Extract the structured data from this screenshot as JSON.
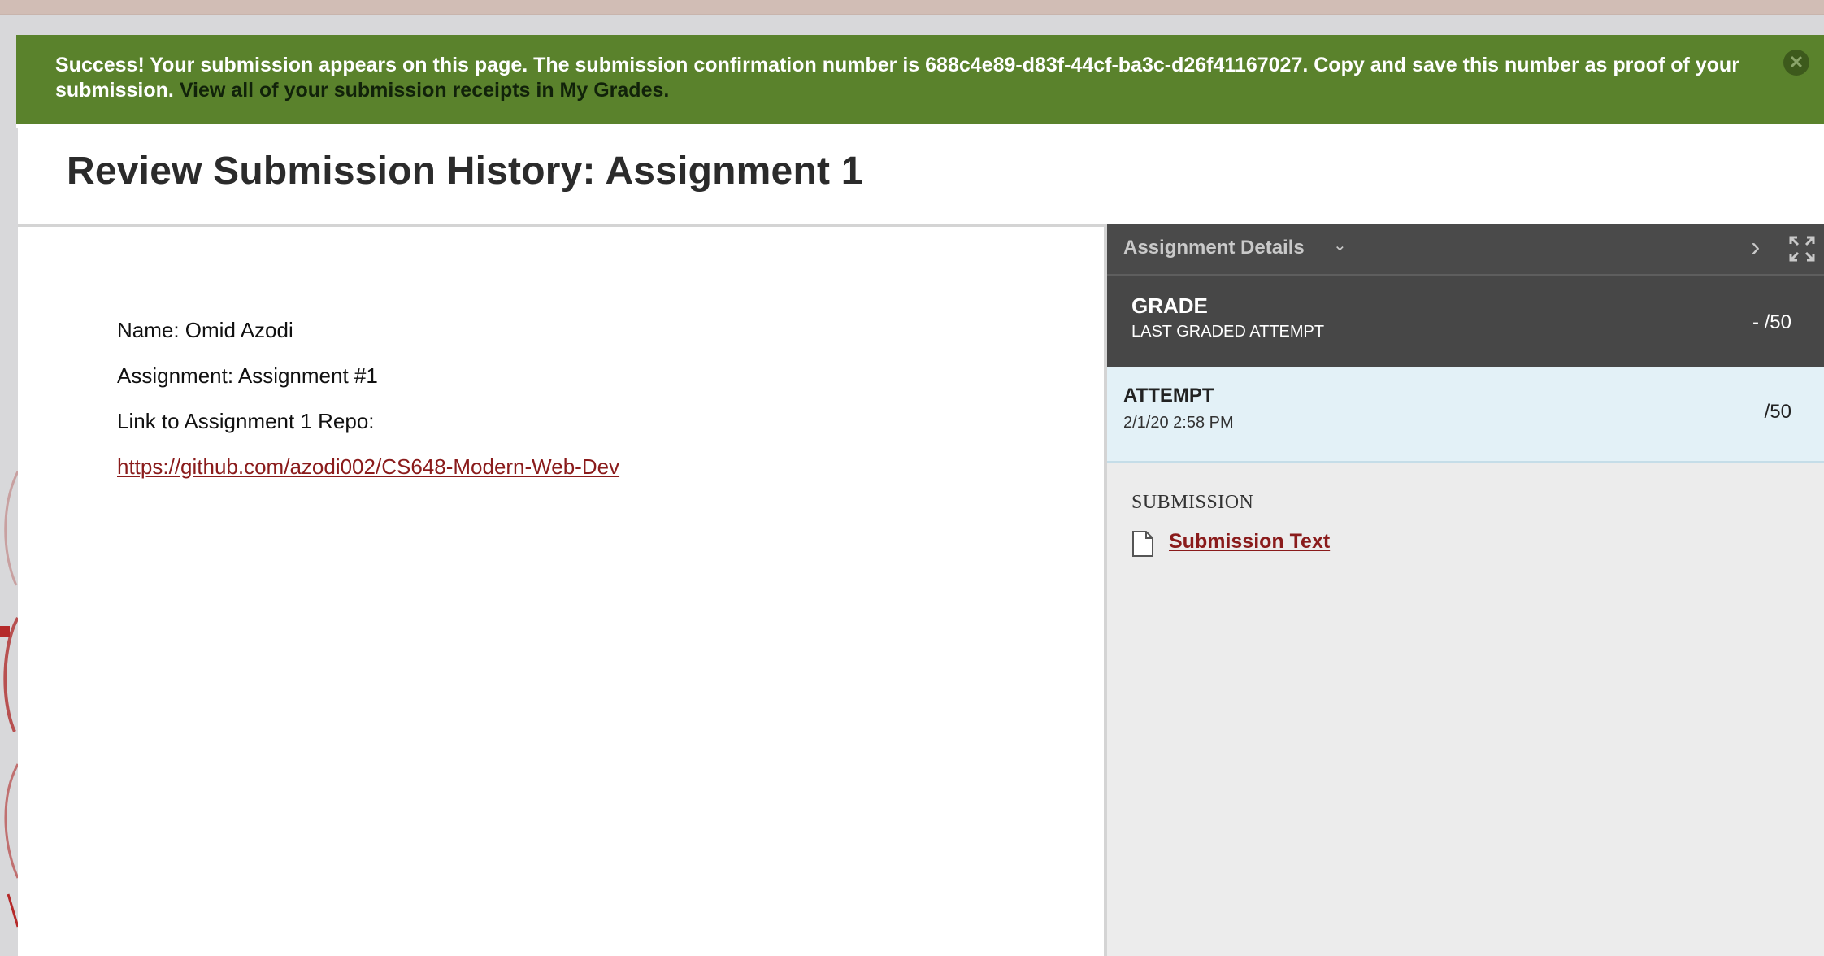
{
  "banner": {
    "message": "Success! Your submission appears on this page. The submission confirmation number is 688c4e89-d83f-44cf-ba3c-d26f41167027. Copy and save this number as proof of your submission.",
    "receipts_link": "View all of your submission receipts in My Grades.",
    "close_icon": "close-circle-icon",
    "color": "#5a822c"
  },
  "page": {
    "title": "Review Submission History: Assignment 1"
  },
  "content": {
    "lines": [
      "Name: Omid Azodi",
      "Assignment: Assignment #1",
      "Link to Assignment 1 Repo:"
    ],
    "repo_link": "https://github.com/azodi002/CS648-Modern-Web-Dev",
    "link_color": "#8a1b1b"
  },
  "sidebar": {
    "title": "Assignment Details",
    "title_icon": "chevron-down-icon",
    "next_icon": "chevron-right-icon",
    "expand_icon": "expand-icon",
    "grade": {
      "label": "GRADE",
      "sublabel": "LAST GRADED ATTEMPT",
      "score": "- /50"
    },
    "attempt": {
      "label": "ATTEMPT",
      "date": "2/1/20 2:58 PM",
      "score": "/50"
    },
    "submission": {
      "heading": "SUBMISSION",
      "link_label": "Submission Text",
      "icon": "document-icon"
    }
  }
}
